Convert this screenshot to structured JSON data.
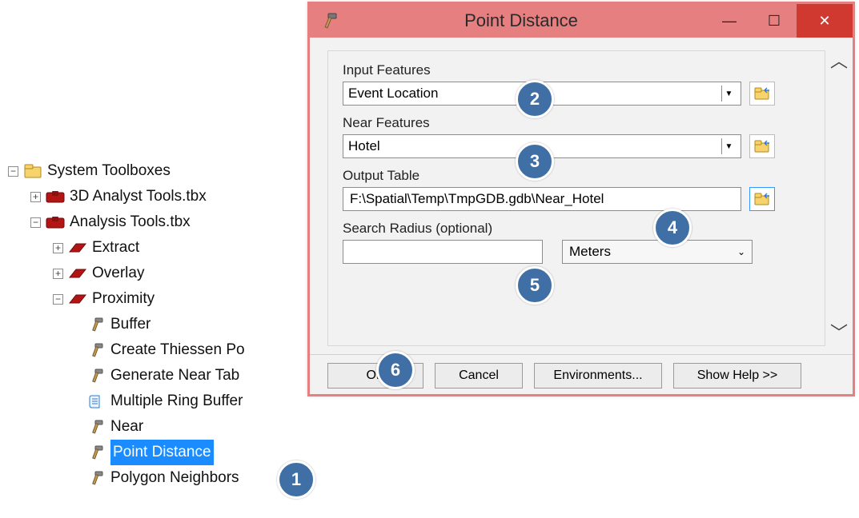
{
  "tree": {
    "root": "System Toolboxes",
    "children": [
      {
        "label": "3D Analyst Tools.tbx",
        "exp": "+"
      },
      {
        "label": "Analysis Tools.tbx",
        "exp": "-",
        "children": [
          {
            "label": "Extract",
            "exp": "+"
          },
          {
            "label": "Overlay",
            "exp": "+"
          },
          {
            "label": "Proximity",
            "exp": "-",
            "children": [
              {
                "label": "Buffer"
              },
              {
                "label": "Create Thiessen Po"
              },
              {
                "label": "Generate Near Tab"
              },
              {
                "label": "Multiple Ring Buffer",
                "script": true
              },
              {
                "label": "Near"
              },
              {
                "label": "Point Distance",
                "selected": true
              },
              {
                "label": "Polygon Neighbors"
              }
            ]
          }
        ]
      }
    ]
  },
  "dialog": {
    "title": "Point Distance",
    "labels": {
      "input_features": "Input Features",
      "near_features": "Near Features",
      "output_table": "Output Table",
      "search_radius": "Search Radius (optional)"
    },
    "values": {
      "input_features": "Event Location",
      "near_features": "Hotel",
      "output_table": "F:\\Spatial\\Temp\\TmpGDB.gdb\\Near_Hotel",
      "search_radius": "",
      "unit": "Meters"
    },
    "buttons": {
      "ok": "OK",
      "cancel": "Cancel",
      "env": "Environments...",
      "help": "Show Help >>"
    }
  },
  "callouts": {
    "c1": "1",
    "c2": "2",
    "c3": "3",
    "c4": "4",
    "c5": "5",
    "c6": "6"
  }
}
